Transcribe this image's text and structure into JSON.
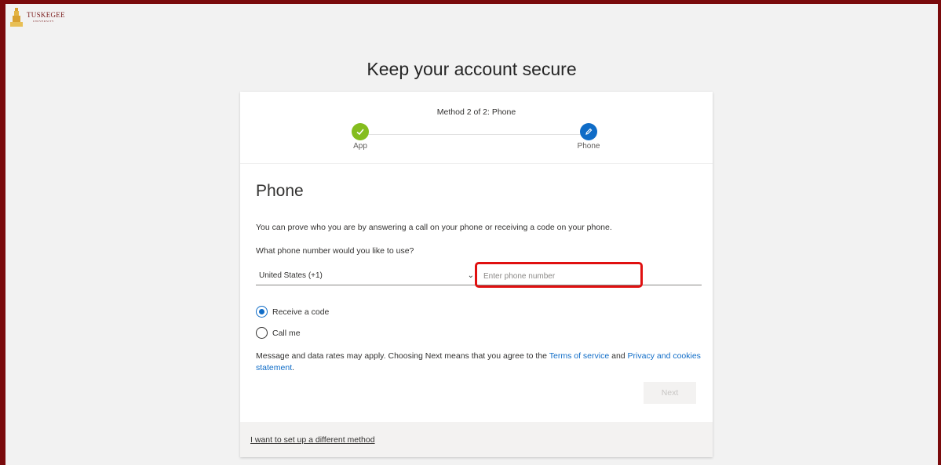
{
  "brand": {
    "name": "TUSKEGEE",
    "sub": "UNIVERSITY"
  },
  "title": "Keep your account secure",
  "progress": {
    "method_label": "Method 2 of 2: Phone",
    "steps": [
      {
        "label": "App",
        "state": "complete",
        "icon": "check-icon",
        "color": "#84bd1e"
      },
      {
        "label": "Phone",
        "state": "current",
        "icon": "pencil-icon",
        "color": "#0f6cc7"
      }
    ]
  },
  "section": {
    "title": "Phone",
    "description": "You can prove who you are by answering a call on your phone or receiving a code on your phone.",
    "question": "What phone number would you like to use?",
    "country_select": {
      "value": "United States (+1)"
    },
    "phone_input": {
      "placeholder": "Enter phone number",
      "value": ""
    },
    "options": [
      {
        "label": "Receive a code",
        "checked": true
      },
      {
        "label": "Call me",
        "checked": false
      }
    ],
    "notice": {
      "text1": "Message and data rates may apply. Choosing Next means that you agree to the ",
      "terms_link": "Terms of service",
      "text2": " and ",
      "privacy_link": "Privacy and cookies statement",
      "text3": "."
    },
    "next_label": "Next"
  },
  "footer": {
    "different_method_link": "I want to set up a different method"
  },
  "colors": {
    "frame": "#7a0a0c",
    "accent": "#0f6cc7",
    "success": "#84bd1e",
    "highlight": "#e01010"
  }
}
